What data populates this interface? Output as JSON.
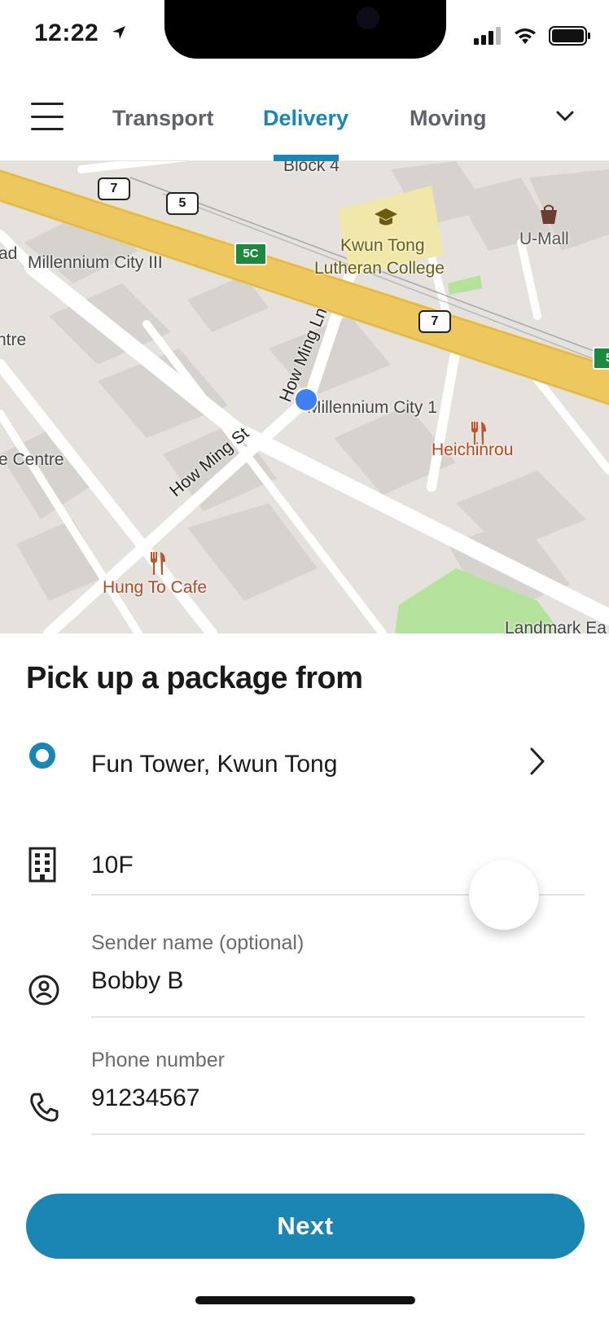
{
  "status_bar": {
    "time": "12:22",
    "icons": [
      "location-arrow-icon",
      "cellular-signal-icon",
      "wifi-icon",
      "battery-icon"
    ]
  },
  "nav": {
    "tabs": [
      {
        "label": "Transport",
        "active": false
      },
      {
        "label": "Delivery",
        "active": true
      },
      {
        "label": "Moving",
        "active": false
      }
    ],
    "accent_color": "#1b86b3"
  },
  "map": {
    "labels": {
      "block4": "Block 4",
      "umall": "U-Mall",
      "kwun_tong_1": "Kwun Tong",
      "kwun_tong_2": "Lutheran College",
      "millennium_city_3": "Millennium City III",
      "ad": "ad",
      "ntre": "ntre",
      "how_ming_ln": "How Ming Ln",
      "millennium_city_1": "Millennium City 1",
      "heichinrou": "Heichinrou",
      "e_centre": "e Centre",
      "how_ming_st": "How Ming St",
      "hung_to_cafe": "Hung To Cafe",
      "landmark": "Landmark Ea"
    },
    "shields": {
      "route_7a": "7",
      "route_5": "5",
      "route_7b": "7",
      "exit_5c": "5C",
      "exit_5_edge": "5"
    }
  },
  "sheet": {
    "title": "Pick up a package from",
    "address": "Fun Tower, Kwun Tong",
    "floor_value": "10F",
    "sender": {
      "label": "Sender name (optional)",
      "value": "Bobby B"
    },
    "phone": {
      "label": "Phone number",
      "value": "91234567"
    },
    "next_label": "Next"
  }
}
